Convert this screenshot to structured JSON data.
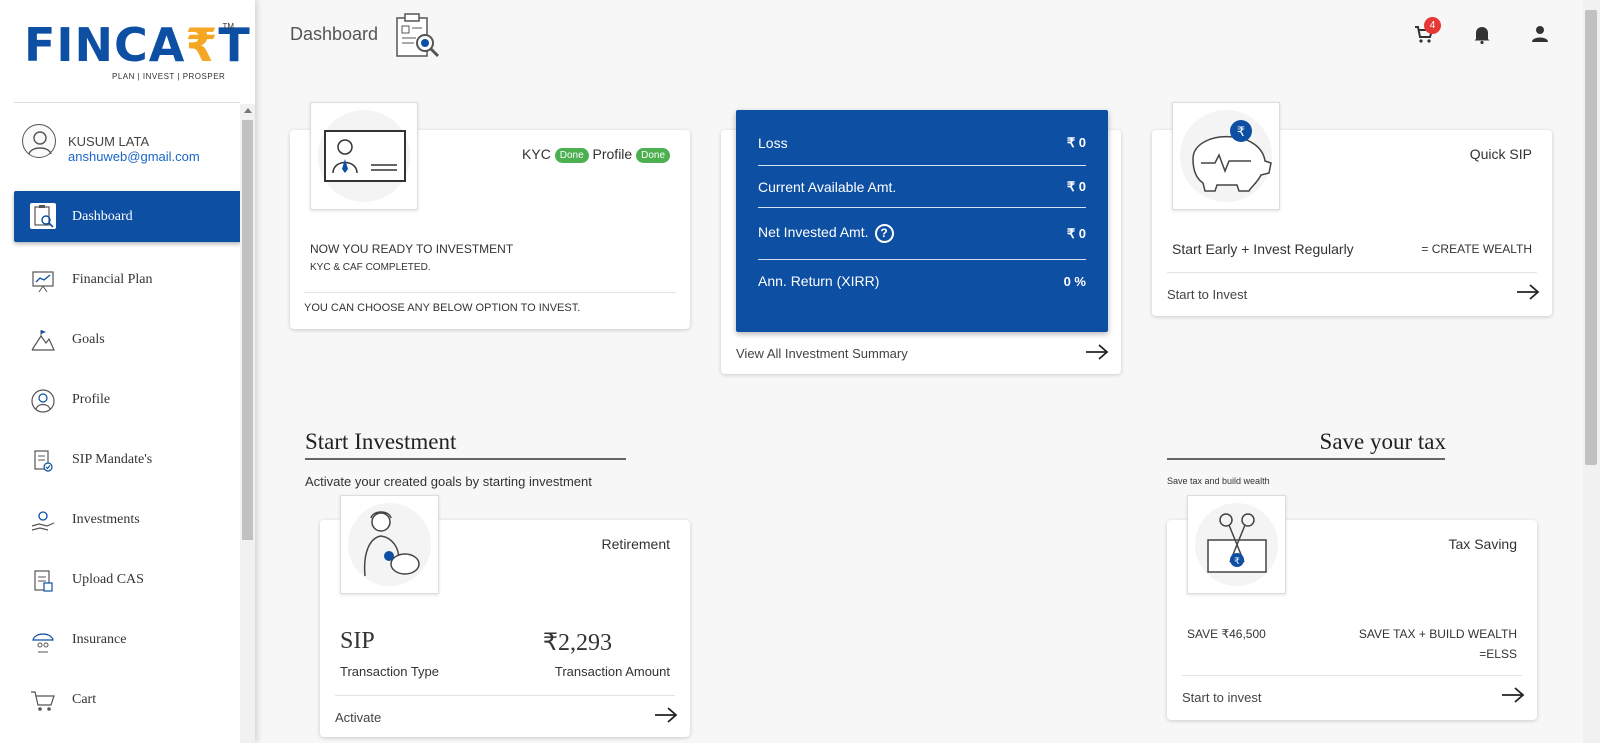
{
  "brand": {
    "name_part1": "FINCA",
    "name_rupee": "₹",
    "name_part2": "T",
    "tm": "TM",
    "tagline": "PLAN | INVEST | PROSPER"
  },
  "user": {
    "name": "KUSUM LATA",
    "email": "anshuweb@gmail.com"
  },
  "sidebar": {
    "items": [
      {
        "label": "Dashboard",
        "icon": "clipboard-search-icon"
      },
      {
        "label": "Financial Plan",
        "icon": "chart-board-icon"
      },
      {
        "label": "Goals",
        "icon": "mountain-flag-icon"
      },
      {
        "label": "Profile",
        "icon": "user-circle-icon"
      },
      {
        "label": "SIP Mandate's",
        "icon": "document-check-icon"
      },
      {
        "label": "Investments",
        "icon": "hand-money-icon"
      },
      {
        "label": "Upload CAS",
        "icon": "upload-document-icon"
      },
      {
        "label": "Insurance",
        "icon": "umbrella-family-icon"
      },
      {
        "label": "Cart",
        "icon": "cart-icon"
      }
    ]
  },
  "header": {
    "title": "Dashboard",
    "cart_count": "4"
  },
  "kyc_card": {
    "kyc_label": "KYC",
    "kyc_badge": "Done",
    "profile_label": "Profile",
    "profile_badge": "Done",
    "line1": "NOW YOU READY TO INVESTMENT",
    "line2": "KYC & CAF COMPLETED.",
    "line3": "YOU CAN CHOOSE ANY BELOW OPTION TO INVEST."
  },
  "summary": {
    "rows": [
      {
        "label": "Loss",
        "value": "₹ 0"
      },
      {
        "label": "Current Available Amt.",
        "value": "₹ 0"
      },
      {
        "label": "Net Invested Amt.",
        "value": "₹ 0"
      },
      {
        "label": "Ann. Return (XIRR)",
        "value": "0 %"
      }
    ],
    "help_symbol": "?",
    "link": "View All Investment Summary"
  },
  "quick_sip": {
    "title": "Quick SIP",
    "tagline_left": "Start Early + Invest Regularly",
    "tagline_right": "= CREATE WEALTH",
    "link": "Start to Invest"
  },
  "start_investment": {
    "title": "Start Investment",
    "subtitle": "Activate your created goals by starting investment",
    "card": {
      "title": "Retirement",
      "type_value": "SIP",
      "type_label": "Transaction Type",
      "amount_value": "₹2,293",
      "amount_label": "Transaction Amount",
      "link": "Activate"
    }
  },
  "save_tax": {
    "title": "Save your tax",
    "subtitle": "Save tax and build wealth",
    "card": {
      "title": "Tax Saving",
      "save_amount": "SAVE ₹46,500",
      "tagline_line1": "SAVE TAX + BUILD WEALTH",
      "tagline_line2": "=ELSS",
      "link": "Start to invest"
    }
  },
  "colors": {
    "primary": "#0d4fa3",
    "accent": "#f5a623",
    "success": "#4caf50",
    "badge": "#e53935"
  }
}
